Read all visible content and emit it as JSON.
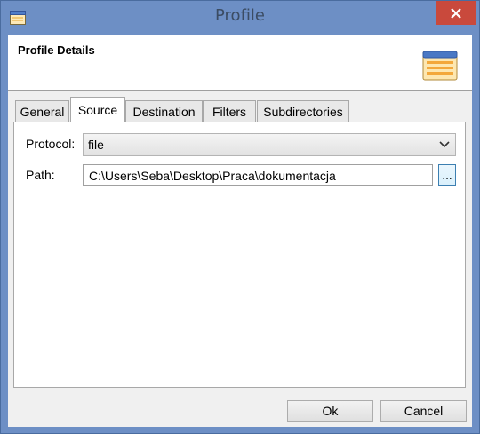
{
  "window": {
    "title": "Profile",
    "close_icon": "close-icon"
  },
  "header": {
    "title": "Profile Details",
    "icon": "profile-details-icon"
  },
  "tabs": [
    {
      "label": "General",
      "active": false
    },
    {
      "label": "Source",
      "active": true
    },
    {
      "label": "Destination",
      "active": false
    },
    {
      "label": "Filters",
      "active": false
    },
    {
      "label": "Subdirectories",
      "active": false
    }
  ],
  "source": {
    "protocol_label": "Protocol:",
    "protocol_value": "file",
    "path_label": "Path:",
    "path_value": "C:\\Users\\Seba\\Desktop\\Praca\\dokumentacja",
    "browse_label": "..."
  },
  "buttons": {
    "ok": "Ok",
    "cancel": "Cancel"
  },
  "colors": {
    "titlebar": "#6d8fc5",
    "close": "#c9493c",
    "icon_accent": "#f5a623"
  }
}
